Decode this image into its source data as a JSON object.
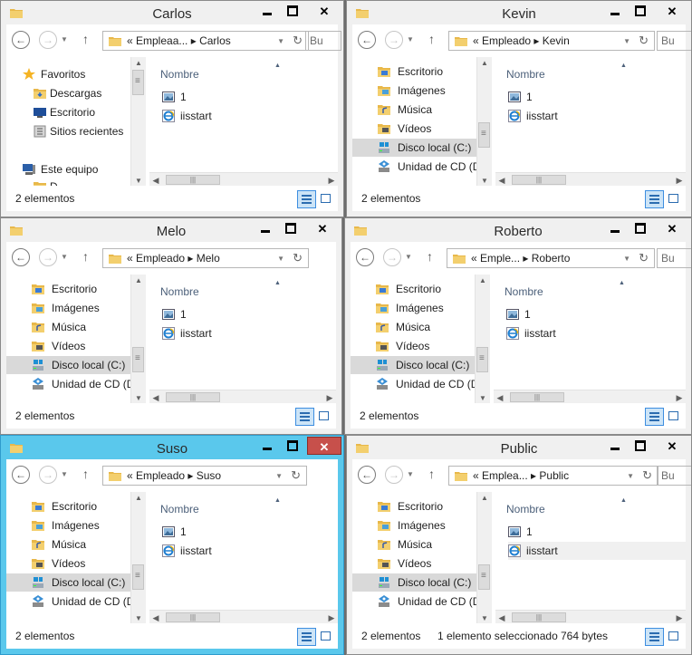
{
  "colors": {
    "active_frame": "#5ac8ec",
    "inactive_frame": "#f0f0f0",
    "close_red": "#c7504b",
    "folder": "#e8b84a",
    "selection": "#d9d9d9"
  },
  "windows": [
    {
      "title": "Carlos",
      "breadcrumb": "«  Empleaa...  ▸  Carlos",
      "search": "Bu",
      "nav": [
        {
          "label": "Favoritos",
          "icon": "star-icon"
        },
        {
          "label": "Descargas",
          "icon": "downloads-folder-icon"
        },
        {
          "label": "Escritorio",
          "icon": "desktop-icon"
        },
        {
          "label": "Sitios recientes",
          "icon": "recent-places-icon"
        },
        {
          "label": "Este equipo",
          "icon": "computer-icon"
        },
        {
          "label": "D",
          "icon": "folder-icon"
        }
      ],
      "column": "Nombre",
      "files": [
        {
          "name": "1",
          "icon": "image-file-icon"
        },
        {
          "name": "iisstart",
          "icon": "html-file-icon"
        }
      ],
      "status": "2 elementos",
      "selected_text": "",
      "size_text": ""
    },
    {
      "title": "Kevin",
      "breadcrumb": "«  Empleado  ▸  Kevin",
      "search": "Bu",
      "nav": [
        {
          "label": "Escritorio",
          "icon": "desktop-folder-icon"
        },
        {
          "label": "Imágenes",
          "icon": "pictures-folder-icon"
        },
        {
          "label": "Música",
          "icon": "music-folder-icon"
        },
        {
          "label": "Vídeos",
          "icon": "videos-folder-icon"
        },
        {
          "label": "Disco local (C:)",
          "icon": "drive-icon"
        },
        {
          "label": "Unidad de CD (D:",
          "icon": "cd-drive-icon"
        }
      ],
      "column": "Nombre",
      "files": [
        {
          "name": "1",
          "icon": "image-file-icon"
        },
        {
          "name": "iisstart",
          "icon": "html-file-icon"
        }
      ],
      "status": "2 elementos",
      "selected_text": "",
      "size_text": ""
    },
    {
      "title": "Melo",
      "breadcrumb": "«  Empleado  ▸  Melo",
      "search": "",
      "nav": [
        {
          "label": "Escritorio",
          "icon": "desktop-folder-icon"
        },
        {
          "label": "Imágenes",
          "icon": "pictures-folder-icon"
        },
        {
          "label": "Música",
          "icon": "music-folder-icon"
        },
        {
          "label": "Vídeos",
          "icon": "videos-folder-icon"
        },
        {
          "label": "Disco local (C:)",
          "icon": "drive-icon"
        },
        {
          "label": "Unidad de CD (D:",
          "icon": "cd-drive-icon"
        }
      ],
      "column": "Nombre",
      "files": [
        {
          "name": "1",
          "icon": "image-file-icon"
        },
        {
          "name": "iisstart",
          "icon": "html-file-icon"
        }
      ],
      "status": "2 elementos",
      "selected_text": "",
      "size_text": ""
    },
    {
      "title": "Roberto",
      "breadcrumb": "«  Emple...  ▸  Roberto",
      "search": "Bu",
      "nav": [
        {
          "label": "Escritorio",
          "icon": "desktop-folder-icon"
        },
        {
          "label": "Imágenes",
          "icon": "pictures-folder-icon"
        },
        {
          "label": "Música",
          "icon": "music-folder-icon"
        },
        {
          "label": "Vídeos",
          "icon": "videos-folder-icon"
        },
        {
          "label": "Disco local (C:)",
          "icon": "drive-icon"
        },
        {
          "label": "Unidad de CD (D:",
          "icon": "cd-drive-icon"
        }
      ],
      "column": "Nombre",
      "files": [
        {
          "name": "1",
          "icon": "image-file-icon"
        },
        {
          "name": "iisstart",
          "icon": "html-file-icon"
        }
      ],
      "status": "2 elementos",
      "selected_text": "",
      "size_text": ""
    },
    {
      "title": "Suso",
      "breadcrumb": "«  Empleado  ▸  Suso",
      "search": "",
      "nav": [
        {
          "label": "Escritorio",
          "icon": "desktop-folder-icon"
        },
        {
          "label": "Imágenes",
          "icon": "pictures-folder-icon"
        },
        {
          "label": "Música",
          "icon": "music-folder-icon"
        },
        {
          "label": "Vídeos",
          "icon": "videos-folder-icon"
        },
        {
          "label": "Disco local (C:)",
          "icon": "drive-icon"
        },
        {
          "label": "Unidad de CD (D:",
          "icon": "cd-drive-icon"
        }
      ],
      "column": "Nombre",
      "files": [
        {
          "name": "1",
          "icon": "image-file-icon"
        },
        {
          "name": "iisstart",
          "icon": "html-file-icon"
        }
      ],
      "status": "2 elementos",
      "selected_text": "",
      "size_text": ""
    },
    {
      "title": "Public",
      "breadcrumb": "«  Emplea...  ▸  Public",
      "search": "Bu",
      "nav": [
        {
          "label": "Escritorio",
          "icon": "desktop-folder-icon"
        },
        {
          "label": "Imágenes",
          "icon": "pictures-folder-icon"
        },
        {
          "label": "Música",
          "icon": "music-folder-icon"
        },
        {
          "label": "Vídeos",
          "icon": "videos-folder-icon"
        },
        {
          "label": "Disco local (C:)",
          "icon": "drive-icon"
        },
        {
          "label": "Unidad de CD (D:",
          "icon": "cd-drive-icon"
        }
      ],
      "column": "Nombre",
      "files": [
        {
          "name": "1",
          "icon": "image-file-icon"
        },
        {
          "name": "iisstart",
          "icon": "html-file-icon"
        }
      ],
      "status": "2 elementos",
      "selected_text": "1 elemento seleccionado",
      "size_text": "764 bytes"
    }
  ]
}
